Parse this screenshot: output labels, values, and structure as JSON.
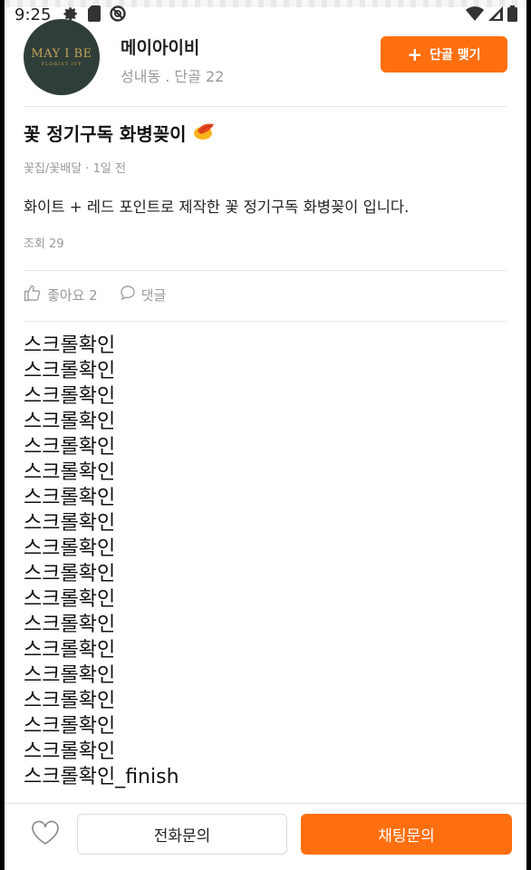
{
  "status_bar": {
    "time": "9:25",
    "left_icons": [
      "gear-icon",
      "sim-icon",
      "do-not-disturb-icon"
    ],
    "right_icons": [
      "wifi-icon",
      "signal-icon",
      "battery-icon"
    ]
  },
  "shop": {
    "logo_text": "MAY I BE",
    "logo_sub": "FLORIST IVY",
    "name": "메이아이비",
    "meta": "성내동 . 단골 22",
    "follow_label": "단골 맺기"
  },
  "post": {
    "title": "꽃 정기구독 화병꽂이",
    "title_emoji": "🌷",
    "meta": "꽃집/꽃배달 · 1일 전",
    "body": "화이트 + 레드 포인트로 제작한 꽃 정기구독 화병꽂이 입니다.",
    "views": "조회 29"
  },
  "actions": {
    "like_label": "좋아요 2",
    "comment_label": "댓글"
  },
  "scroll_lines": [
    "스크롤확인",
    "스크롤확인",
    "스크롤확인",
    "스크롤확인",
    "스크롤확인",
    "스크롤확인",
    "스크롤확인",
    "스크롤확인",
    "스크롤확인",
    "스크롤확인",
    "스크롤확인",
    "스크롤확인",
    "스크롤확인",
    "스크롤확인",
    "스크롤확인",
    "스크롤확인",
    "스크롤확인",
    "스크롤확인_finish"
  ],
  "bottom": {
    "call_label": "전화문의",
    "chat_label": "채팅문의"
  },
  "colors": {
    "accent": "#ff6f0f",
    "muted": "#999999"
  }
}
